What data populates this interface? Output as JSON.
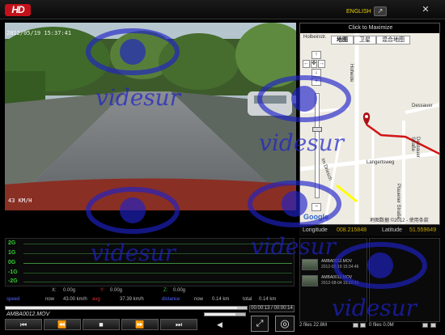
{
  "app": {
    "logo": "HD",
    "language": "ENGLISH",
    "lang_icon": "arrow-icon",
    "close": "✕"
  },
  "video": {
    "timestamp": "2012/05/19 15:37:41",
    "speed_overlay": "43 KM/H"
  },
  "map": {
    "header": "Click to Maximize",
    "tabs": [
      "地图",
      "卫星",
      "混合地图"
    ],
    "zoom_buttons": [
      "↑",
      "←",
      "✥",
      "→",
      "↓",
      "+"
    ],
    "zoom_minus": "−",
    "labels": {
      "street1": "Holbeinstr.",
      "street2": "Dessauer",
      "street3": "Langertsweg",
      "street4": "Plauener Straße",
      "street5": "Im Driesch",
      "street6": "Dessauer Straße",
      "top_left": "Hoheide"
    },
    "logo": "Google",
    "copyright": "地图数据 ©2012 - 使用条款",
    "route_color": "#d21414"
  },
  "coords": {
    "lon_label": "Longitude",
    "lon_value": "008.215848",
    "lat_label": "Latitude",
    "lat_value": "51.559649"
  },
  "gsensor": {
    "levels": [
      "2G",
      "1G",
      "0G",
      "-1G",
      "-2G"
    ]
  },
  "stats": {
    "blank1": "",
    "x_label": "X:",
    "x_value": "0.00g",
    "y_label": "Y:",
    "y_value": "0.00g",
    "z_label": "Z:",
    "z_value": "0.00g",
    "speed_label": "speed",
    "now_label": "now",
    "now_value": "43.00 km/h",
    "avg_label": "avg",
    "avg_value": "37.39 km/h",
    "dist_label": "distance",
    "dist_now": "now",
    "dist_now_value": "0.14 km",
    "total_label": "total",
    "total_value": "0.14 km"
  },
  "player": {
    "filename": "AMBA0012.MOV",
    "time": "00:00:13 / 00:00:14",
    "progress": 0.96,
    "volume": 0.75,
    "buttons": [
      "⏮",
      "⏪",
      "■",
      "⏩",
      "⏭"
    ],
    "speaker": "◀",
    "fullscreen": "⤢",
    "snapshot": "◎"
  },
  "files": [
    {
      "name": "AMBA0012.MOV",
      "date": "2012-05-19  15:34:46"
    },
    {
      "name": "AMBA0012.MOV",
      "date": "2012-08-04  15:32:41"
    }
  ],
  "files_status": "2 files 22.8M",
  "files2_status": "0 files 0.0M",
  "watermark": "videsur"
}
